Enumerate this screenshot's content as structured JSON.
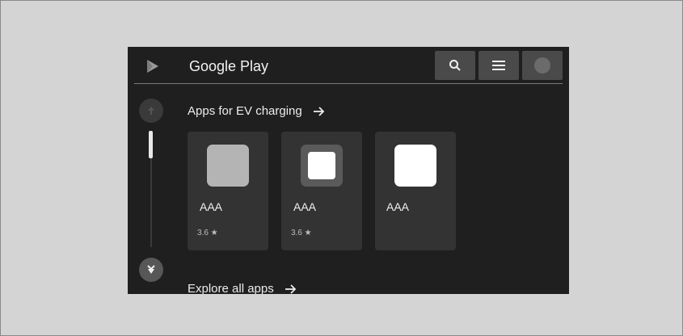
{
  "header": {
    "title": "Google Play"
  },
  "sections": [
    {
      "title": "Apps for EV charging",
      "apps": [
        {
          "name": "AAA",
          "rating": "3.6 ★"
        },
        {
          "name": "AAA",
          "rating": "3.6 ★"
        },
        {
          "name": "AAA",
          "rating": ""
        }
      ]
    },
    {
      "title": "Explore all apps"
    }
  ],
  "icons": {
    "logo": "play-logo-icon",
    "search": "search-icon",
    "menu": "menu-icon",
    "profile": "avatar",
    "section_arrow": "arrow-right-icon",
    "scroll_up": "scroll-up-icon",
    "scroll_down": "scroll-down-icon"
  },
  "colors": {
    "screen_background": "#1f1f1f",
    "card_background": "#333333",
    "toolbar_button": "#4a4a4a",
    "outer_background": "#d4d4d4"
  }
}
